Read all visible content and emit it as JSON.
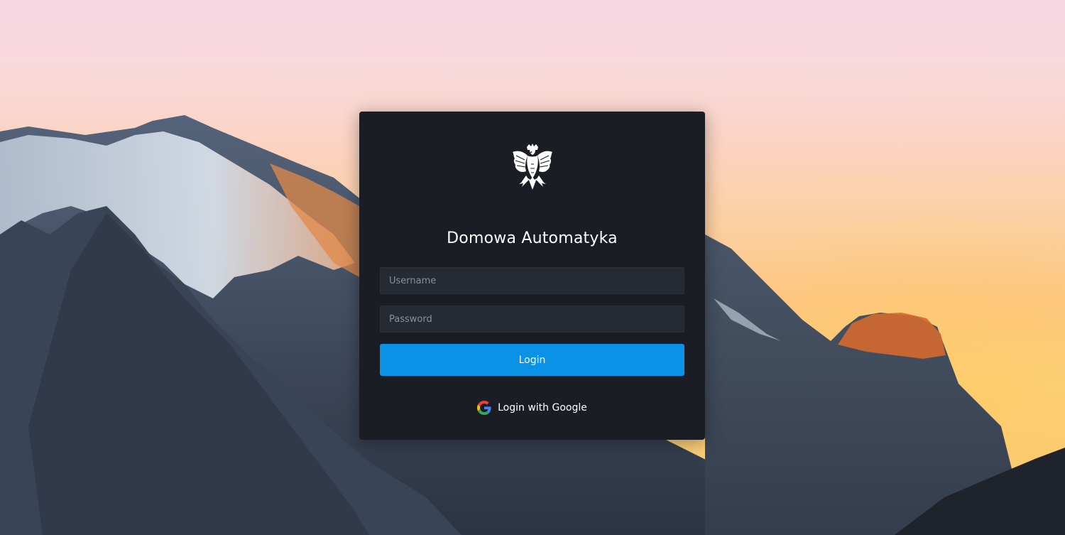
{
  "app": {
    "title": "Domowa Automatyka"
  },
  "login_form": {
    "username_placeholder": "Username",
    "password_placeholder": "Password",
    "login_label": "Login",
    "google_label": "Login with Google"
  },
  "icons": {
    "logo": "polish-eagle-emblem",
    "google": "google-g-icon"
  },
  "colors": {
    "card_background": "#1b1d24",
    "input_background": "#262a33",
    "primary_button": "#0a92e6",
    "text": "#ffffff"
  }
}
